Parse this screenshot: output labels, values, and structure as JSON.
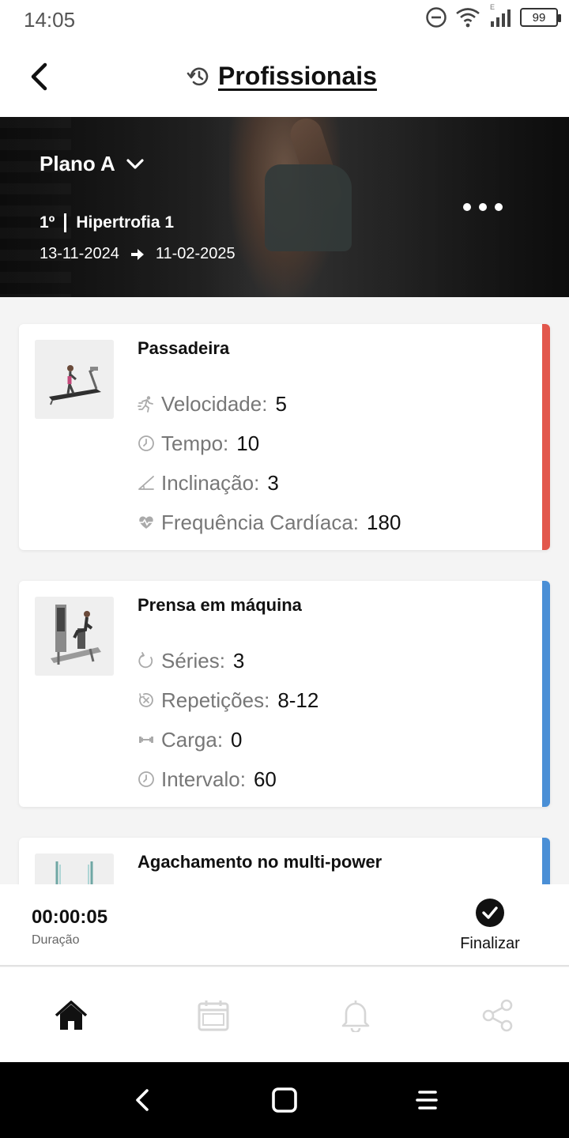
{
  "status_bar": {
    "time": "14:05",
    "battery": "99",
    "network_label": "E"
  },
  "header": {
    "title": "Profissionais"
  },
  "plan": {
    "name": "Plano A",
    "order": "1º",
    "program": "Hipertrofia 1",
    "start_date": "13-11-2024",
    "end_date": "11-02-2025"
  },
  "exercises": [
    {
      "name": "Passadeira",
      "accent_color": "#e2574c",
      "stats": [
        {
          "label": "Velocidade:",
          "value": "5",
          "icon": "runner-icon"
        },
        {
          "label": "Tempo:",
          "value": "10",
          "icon": "clock-icon"
        },
        {
          "label": "Inclinação:",
          "value": "3",
          "icon": "incline-icon"
        },
        {
          "label": "Frequência Cardíaca:",
          "value": "180",
          "icon": "heart-rate-icon"
        }
      ]
    },
    {
      "name": "Prensa em máquina",
      "accent_color": "#4a8fd6",
      "stats": [
        {
          "label": "Séries:",
          "value": "3",
          "icon": "series-icon"
        },
        {
          "label": "Repetições:",
          "value": "8-12",
          "icon": "repeat-icon"
        },
        {
          "label": "Carga:",
          "value": "0",
          "icon": "dumbbell-icon"
        },
        {
          "label": "Intervalo:",
          "value": "60",
          "icon": "clock-icon"
        }
      ]
    },
    {
      "name": "Agachamento no multi-power",
      "accent_color": "#4a8fd6",
      "stats": []
    }
  ],
  "session": {
    "duration": "00:00:05",
    "duration_label": "Duração",
    "finish_label": "Finalizar"
  },
  "tabs": [
    {
      "name": "home-icon",
      "active": true
    },
    {
      "name": "calendar-icon",
      "active": false
    },
    {
      "name": "bell-icon",
      "active": false
    },
    {
      "name": "share-icon",
      "active": false
    }
  ],
  "colors": {
    "accent_red": "#e2574c",
    "accent_blue": "#4a8fd6",
    "tab_inactive": "#d6d6d6"
  }
}
